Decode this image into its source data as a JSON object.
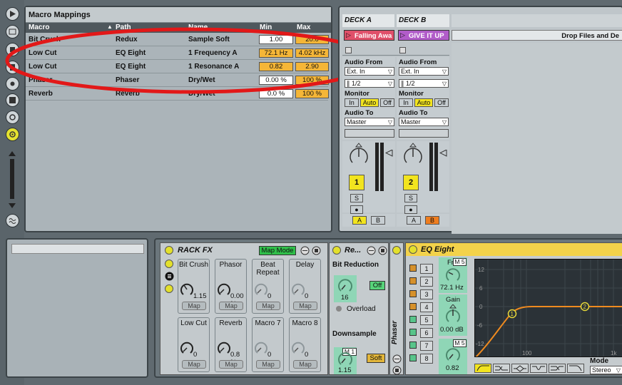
{
  "macro_mappings": {
    "title": "Macro Mappings",
    "columns": [
      "Macro",
      "Path",
      "Name",
      "Min",
      "Max"
    ],
    "rows": [
      {
        "macro": "Bit Crush",
        "path": "Redux",
        "name": "Sample Soft",
        "min": "1.00",
        "max": "20.0"
      },
      {
        "macro": "Low Cut",
        "path": "EQ Eight",
        "name": "1 Frequency A",
        "min": "72.1 Hz",
        "max": "4.02 kHz"
      },
      {
        "macro": "Low Cut",
        "path": "EQ Eight",
        "name": "1 Resonance A",
        "min": "0.82",
        "max": "2.90"
      },
      {
        "macro": "Phaser",
        "path": "Phaser",
        "name": "Dry/Wet",
        "min": "0.00 %",
        "max": "100 %"
      },
      {
        "macro": "Reverb",
        "path": "Reverb",
        "name": "Dry/Wet",
        "min": "0.0 %",
        "max": "100 %"
      }
    ]
  },
  "decks": {
    "a": {
      "title": "DECK A",
      "clip": "Falling Awa",
      "audio_from_label": "Audio From",
      "audio_from": "Ext. In",
      "channel": "1/2",
      "monitor_label": "Monitor",
      "monitor_in": "In",
      "monitor_auto": "Auto",
      "monitor_off": "Off",
      "audio_to_label": "Audio To",
      "audio_to": "Master",
      "track_num": "1",
      "solo": "S",
      "xfade_a": "A",
      "xfade_b": "B"
    },
    "b": {
      "title": "DECK B",
      "clip": "GIVE IT UP",
      "audio_from_label": "Audio From",
      "audio_from": "Ext. In",
      "channel": "1/2",
      "monitor_label": "Monitor",
      "monitor_in": "In",
      "monitor_auto": "Auto",
      "monitor_off": "Off",
      "audio_to_label": "Audio To",
      "audio_to": "Master",
      "track_num": "2",
      "solo": "S",
      "xfade_a": "A",
      "xfade_b": "B"
    },
    "drop_text": "Drop Files and De"
  },
  "rack": {
    "title": "RACK FX",
    "map_mode": "Map Mode",
    "macros": [
      {
        "name": "Bit Crush",
        "value": "1.15",
        "map": "Map"
      },
      {
        "name": "Phasor",
        "value": "0.00 %",
        "map": "Map"
      },
      {
        "name": "Beat Repeat",
        "value": "0",
        "map": "Map"
      },
      {
        "name": "Delay",
        "value": "0",
        "map": "Map"
      },
      {
        "name": "Low Cut",
        "value": "0",
        "map": "Map"
      },
      {
        "name": "Reverb",
        "value": "0.8 %",
        "map": "Map"
      },
      {
        "name": "Macro 7",
        "value": "0",
        "map": "Map"
      },
      {
        "name": "Macro 8",
        "value": "0",
        "map": "Map"
      }
    ]
  },
  "redux": {
    "title": "Re...",
    "bit_reduction": "Bit Reduction",
    "bit_value": "16",
    "off": "Off",
    "overload": "Overload",
    "downsample": "Downsample",
    "ds_tag": "M 1",
    "ds_value": "1.15",
    "soft": "Soft"
  },
  "phaser": {
    "title": "Phaser"
  },
  "eq": {
    "title": "EQ Eight",
    "freq_label": "Freq",
    "freq_tag": "M 5",
    "freq_value": "72.1 Hz",
    "gain_label": "Gain",
    "gain_value": "0.00 dB",
    "q_tag": "M 5",
    "q_value": "0.82",
    "bands": [
      "1",
      "2",
      "3",
      "4",
      "5",
      "6",
      "7",
      "8"
    ],
    "y_ticks": [
      "12",
      "6",
      "0",
      "-6",
      "-12"
    ],
    "x_ticks": [
      "100",
      "1k"
    ],
    "mode_label": "Mode",
    "mode_value": "Stereo",
    "node1": "1",
    "node2": "2"
  },
  "colors": {
    "accent_yellow": "#f2e41f",
    "accent_orange": "#ef7d1f",
    "curve": "#ef8a1f",
    "clip_a": "#e0506a",
    "clip_b": "#b15cc9"
  }
}
